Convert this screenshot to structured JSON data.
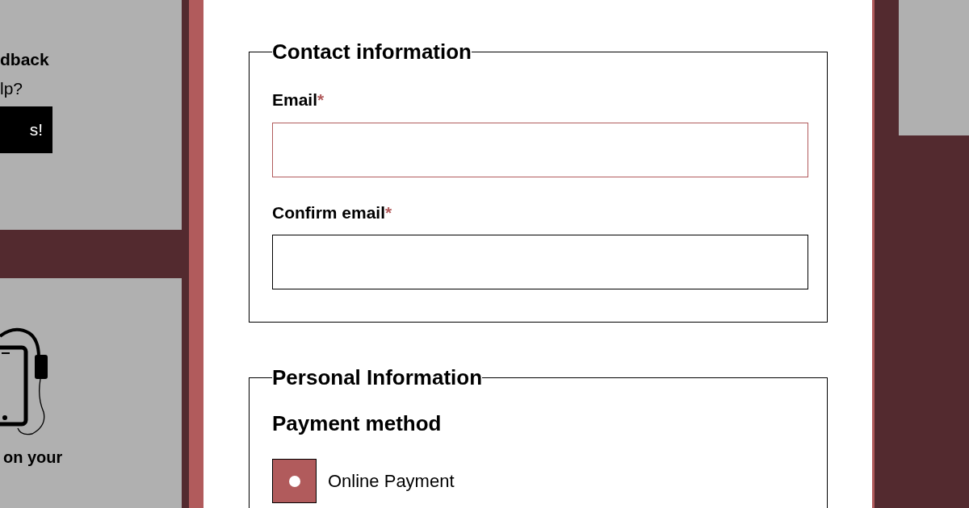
{
  "left_panel": {
    "feedback_heading": "dback",
    "feedback_question": "lp?",
    "feedback_button": "s!",
    "app_heading": "on your"
  },
  "fieldsets": [
    {
      "legend": "Contact information",
      "fields": [
        {
          "label": "Email",
          "required_mark": "*",
          "invalid": true
        },
        {
          "label": "Confirm email",
          "required_mark": "*",
          "invalid": false
        }
      ]
    },
    {
      "legend": "Personal Information",
      "heading": "Payment method",
      "options": [
        {
          "label": "Online Payment",
          "selected": true
        }
      ]
    }
  ]
}
